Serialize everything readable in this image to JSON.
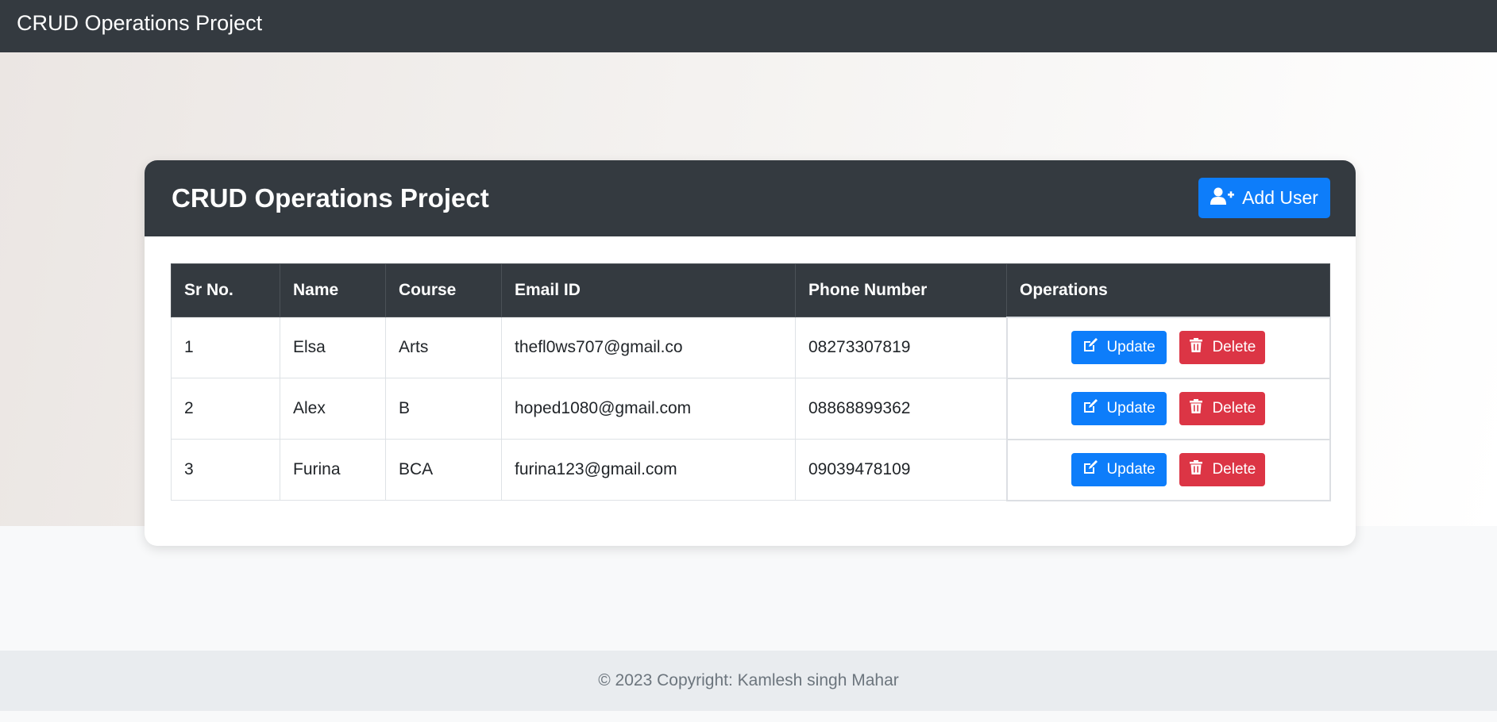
{
  "navbar": {
    "brand": "CRUD Operations Project"
  },
  "card": {
    "title": "CRUD Operations Project",
    "add_button_label": "Add User",
    "add_button_icon": "user-plus-icon"
  },
  "table": {
    "columns": [
      "Sr No.",
      "Name",
      "Course",
      "Email ID",
      "Phone Number",
      "Operations"
    ],
    "rows": [
      {
        "sr": "1",
        "name": "Elsa",
        "course": "Arts",
        "email": "thefl0ws707@gmail.co",
        "phone": "08273307819"
      },
      {
        "sr": "2",
        "name": "Alex",
        "course": "B",
        "email": "hoped1080@gmail.com",
        "phone": "08868899362"
      },
      {
        "sr": "3",
        "name": "Furina",
        "course": "BCA",
        "email": "furina123@gmail.com",
        "phone": "09039478109"
      }
    ],
    "update_label": "Update",
    "delete_label": "Delete",
    "update_icon": "edit-icon",
    "delete_icon": "trash-icon"
  },
  "footer": {
    "text": "© 2023 Copyright: Kamlesh singh Mahar"
  },
  "colors": {
    "dark": "#343a40",
    "primary": "#0d7dfa",
    "danger": "#dc3545",
    "footer_bg": "#e9ecef"
  }
}
